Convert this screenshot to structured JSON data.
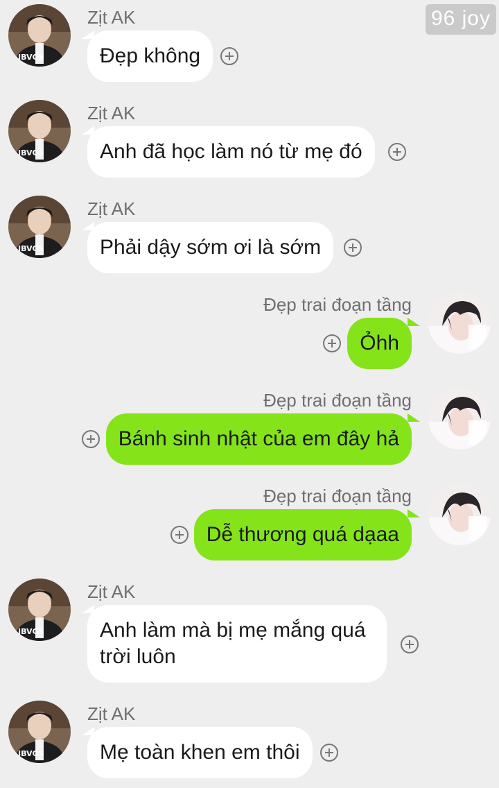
{
  "watermark": "96 joy",
  "messages": [
    {
      "sender": "Zịt AK",
      "text": "Đẹp không",
      "direction": "incoming"
    },
    {
      "sender": "Zịt AK",
      "text": "Anh đã học làm nó từ mẹ đó",
      "direction": "incoming"
    },
    {
      "sender": "Zịt AK",
      "text": "Phải dậy sớm ơi là sớm",
      "direction": "incoming"
    },
    {
      "sender": "Đẹp trai đoạn tầng",
      "text": "Ỏhh",
      "direction": "outgoing"
    },
    {
      "sender": "Đẹp trai đoạn tầng",
      "text": "Bánh sinh nhật của em đây hả",
      "direction": "outgoing"
    },
    {
      "sender": "Đẹp trai đoạn tầng",
      "text": "Dễ thương quá dạaa",
      "direction": "outgoing"
    },
    {
      "sender": "Zịt AK",
      "text": "Anh làm mà bị mẹ mắng quá trời luôn",
      "direction": "incoming"
    },
    {
      "sender": "Zịt AK",
      "text": "Mẹ toàn khen em thôi",
      "direction": "incoming"
    }
  ],
  "colors": {
    "background": "#eeeeee",
    "incoming_bubble": "#ffffff",
    "outgoing_bubble": "#85e31a",
    "name_text": "#6f6f6f"
  },
  "icons": {
    "add_reaction": "plus-circle-icon",
    "avatar_incoming": "avatar-dark-jacket",
    "avatar_outgoing": "avatar-light-white"
  }
}
